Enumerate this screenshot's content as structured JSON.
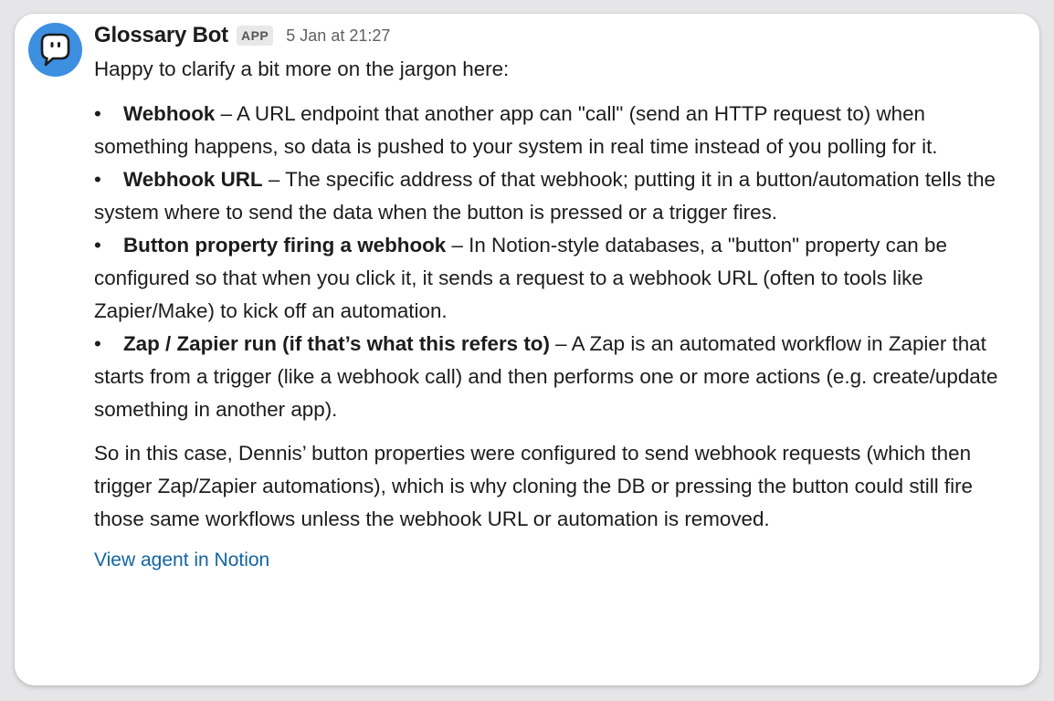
{
  "message": {
    "sender": "Glossary Bot",
    "badge": "APP",
    "timestamp": "5 Jan at 21:27",
    "intro": "Happy to clarify a bit more on the jargon here:",
    "bullets": [
      {
        "marker": "•",
        "term": "Webhook",
        "text": " – A URL endpoint that another app can \"call\" (send an HTTP request to) when something happens, so data is pushed to your system in real time instead of you polling for it."
      },
      {
        "marker": "•",
        "term": "Webhook URL",
        "text": " – The specific address of that webhook; putting it in a button/automation tells the system where to send the data when the button is pressed or a trigger fires."
      },
      {
        "marker": "•",
        "term": "Button property firing a webhook",
        "text": " – In Notion-style databases, a \"button\" property can be configured so that when you click it, it sends a request to a webhook URL (often to tools like Zapier/Make) to kick off an automation."
      },
      {
        "marker": "•",
        "term": "Zap / Zapier run (if that’s what this refers to)",
        "text": " – A Zap is an automated workflow in Zapier that starts from a trigger (like a webhook call) and then performs one or more actions (e.g. create/update something in another app)."
      }
    ],
    "summary": "So in this case, Dennis’ button properties were configured to send webhook requests (which then trigger Zap/Zapier automations), which is why cloning the DB or pressing the button could still fire those same workflows unless the webhook URL or automation is removed.",
    "link_label": "View agent in Notion"
  },
  "colors": {
    "avatar_bg": "#3d8fe0",
    "link": "#1264a3",
    "text": "#1d1c1d",
    "muted": "#616061"
  },
  "icons": {
    "avatar": "speech-bubble-icon"
  }
}
